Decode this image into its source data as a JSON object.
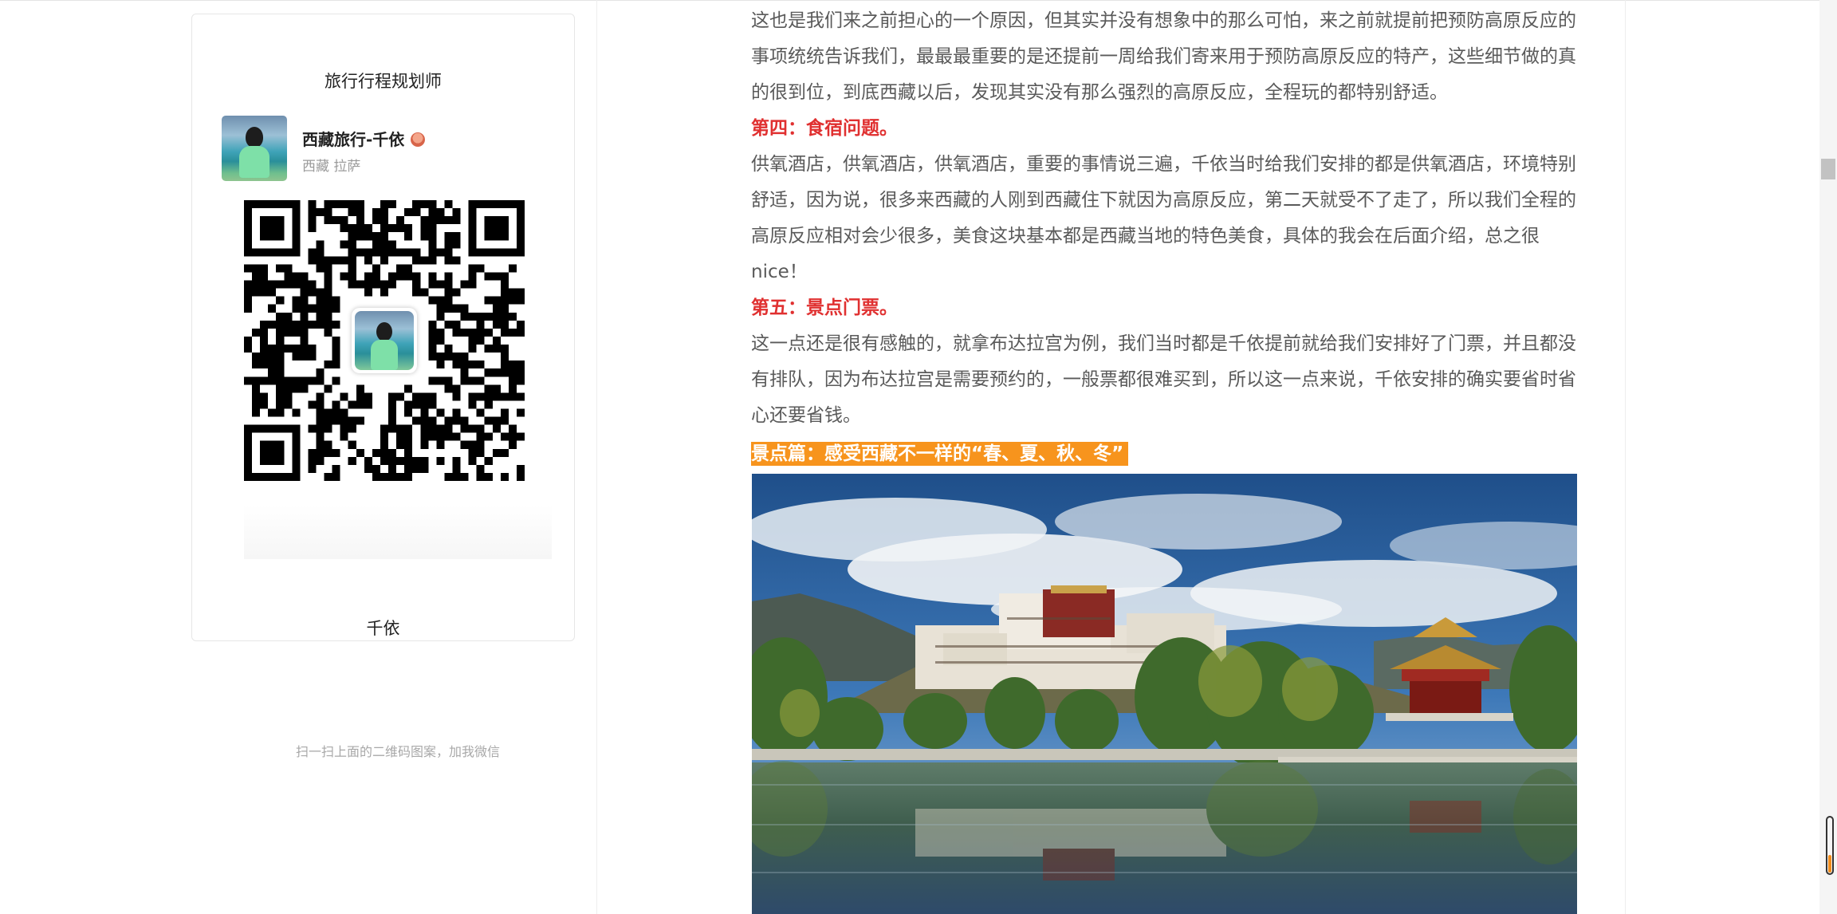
{
  "sidebar": {
    "card_title": "旅行行程规划师",
    "profile": {
      "name": "西藏旅行-千依",
      "location": "西藏 拉萨"
    },
    "qr_hint": "扫一扫上面的二维码图案，加我微信",
    "footer_name": "千依"
  },
  "article": {
    "paragraphs": [
      "这也是我们来之前担心的一个原因，但其实并没有想象中的那么可怕，来之前就提前把预防高原反应的事项统统告诉我们，最最最重要的是还提前一周给我们寄来用于预防高原反应的特产，这些细节做的真的很到位，到底西藏以后，发现其实没有那么强烈的高原反应，全程玩的都特别舒适。",
      "第四：食宿问题。",
      "供氧酒店，供氧酒店，供氧酒店，重要的事情说三遍，千依当时给我们安排的都是供氧酒店，环境特别舒适，因为说，很多来西藏的人刚到西藏住下就因为高原反应，第二天就受不了走了，所以我们全程的高原反应相对会少很多，美食这块基本都是西藏当地的特色美食，具体的我会在后面介绍，总之很nice！",
      "第五：景点门票。",
      "这一点还是很有感触的，就拿布达拉宫为例，我们当时都是千依提前就给我们安排好了门票，并且都没有排队，因为布达拉宫是需要预约的，一般票都很难买到，所以这一点来说，千依安排的确实要省时省心还要省钱。"
    ],
    "section_highlight": "景点篇：感受西藏不一样的“春、夏、秋、冬”"
  },
  "colors": {
    "heading_red": "#e03030",
    "highlight_orange": "#f7941d",
    "body_text": "#5a5a5a"
  },
  "icons": {
    "profile_badge": "emoji-badge-icon",
    "qr_center_avatar": "avatar-icon"
  }
}
